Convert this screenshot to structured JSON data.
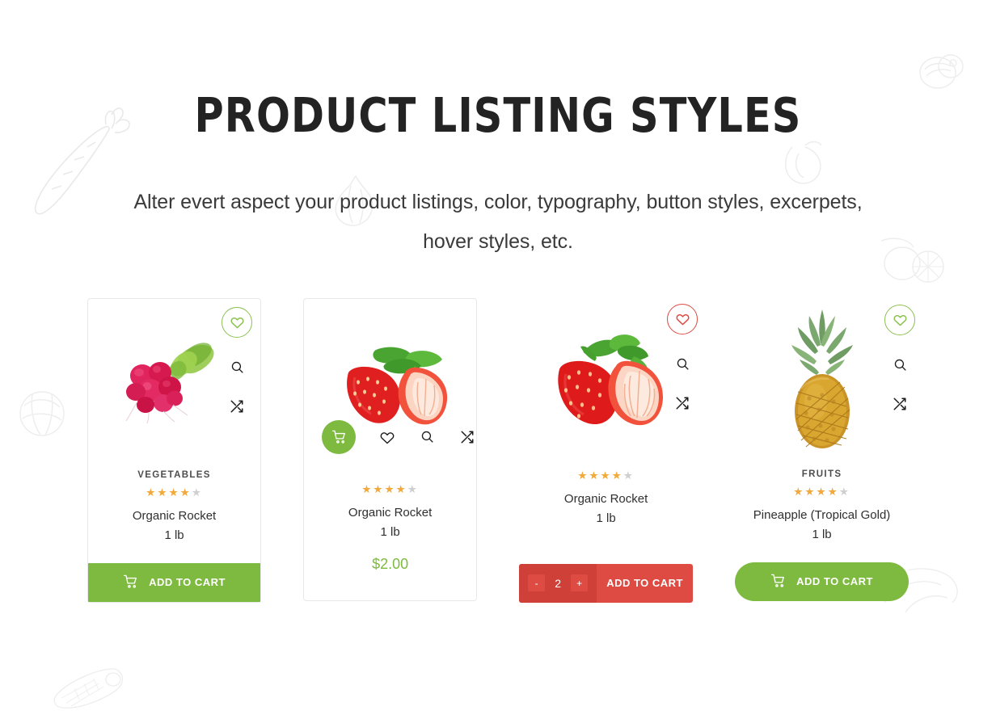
{
  "header": {
    "title": "PRODUCT LISTING STYLES",
    "subtitle": "Alter evert aspect your product listings, color, typography, button styles, excerpets, hover styles, etc."
  },
  "colors": {
    "green": "#7dba3f",
    "green_outline": "#8cc152",
    "red": "#dd4b43",
    "red_dark": "#cf4039",
    "star_on": "#f2a93b",
    "star_off": "#cfcfcf",
    "text": "#2f2f2f",
    "card_border": "#e8e8e8"
  },
  "products": [
    {
      "image": "radishes-photo",
      "category": "VEGETABLES",
      "rating": 4,
      "rating_max": 5,
      "name": "Organic Rocket",
      "weight": "1 lb",
      "price": null,
      "add_to_cart_label": "ADD TO CART",
      "actions": [
        "wishlist-heart",
        "quick-view-search",
        "compare-shuffle"
      ]
    },
    {
      "image": "strawberries-photo",
      "category": null,
      "rating": 4,
      "rating_max": 5,
      "name": "Organic Rocket",
      "weight": "1 lb",
      "price": "$2.00",
      "add_to_cart_label": null,
      "actions": [
        "add-to-cart",
        "wishlist-heart",
        "quick-view-search",
        "compare-shuffle"
      ]
    },
    {
      "image": "strawberry-pair-photo",
      "category": null,
      "rating": 4,
      "rating_max": 5,
      "name": "Organic Rocket",
      "weight": "1 lb",
      "price": null,
      "add_to_cart_label": "ADD TO CART",
      "quantity": "2",
      "qty_decrease_label": "-",
      "qty_increase_label": "+",
      "actions": [
        "wishlist-heart",
        "quick-view-search",
        "compare-shuffle"
      ]
    },
    {
      "image": "pineapple-photo",
      "category": "FRUITS",
      "rating": 4,
      "rating_max": 5,
      "name": "Pineapple (Tropical Gold)",
      "weight": "1 lb",
      "price": null,
      "add_to_cart_label": "ADD TO CART",
      "actions": [
        "wishlist-heart",
        "quick-view-search",
        "compare-shuffle"
      ]
    }
  ],
  "decorations": [
    "carrot-outline",
    "garlic-outline",
    "onion-outline",
    "pepper-outline",
    "lemon-outline",
    "cabbage-outline",
    "corn-outline",
    "wave-outline"
  ]
}
